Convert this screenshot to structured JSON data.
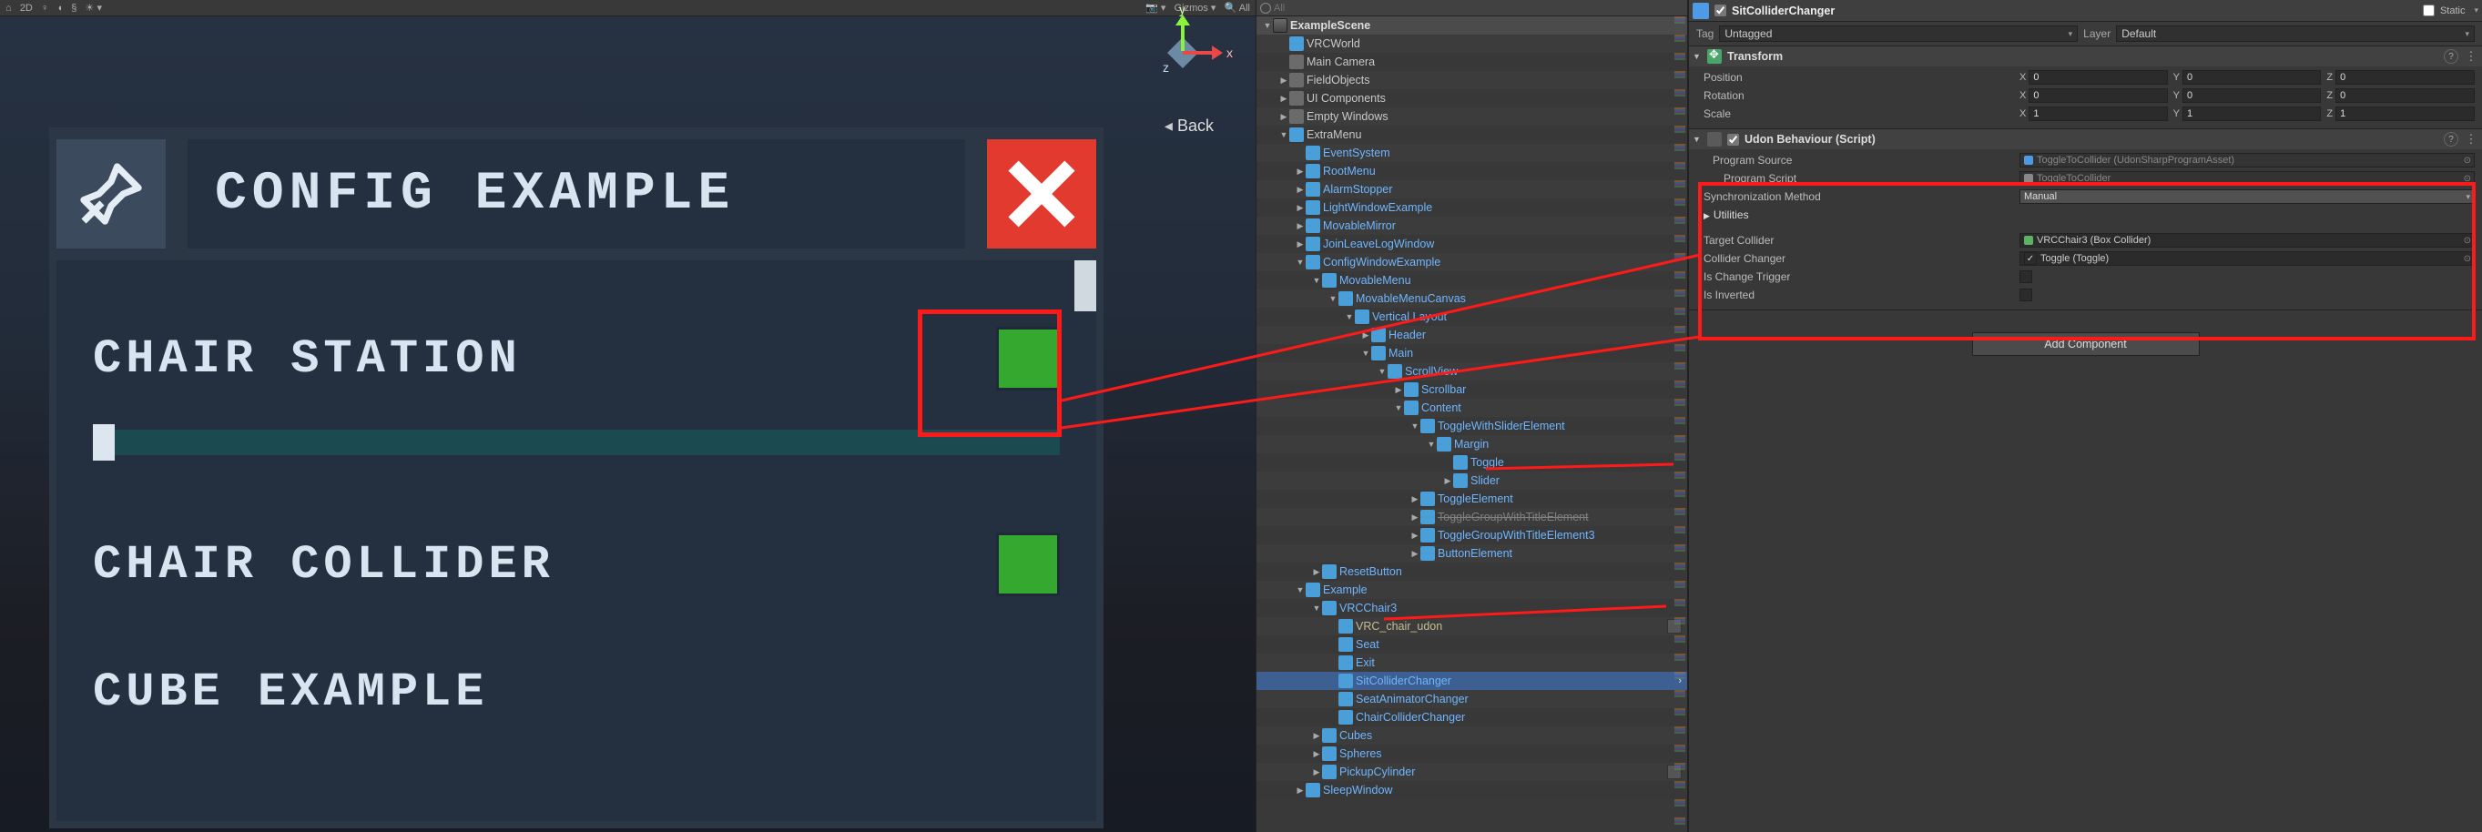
{
  "scene_toolbar": {
    "items": [
      "⌂",
      "2D",
      "♀",
      "◖",
      "§",
      "☀",
      "▾",
      "",
      "",
      "📷",
      "▾",
      "Gizmos",
      "▾",
      "🔍 All"
    ]
  },
  "scene_gizmo": {
    "x": "x",
    "y": "y",
    "z": "z",
    "back": "Back"
  },
  "config_panel": {
    "title": "CONFIG EXAMPLE",
    "rows": [
      {
        "label": "CHAIR STATION",
        "type": "toggle"
      },
      {
        "label": "",
        "type": "slider"
      },
      {
        "label": "CHAIR COLLIDER",
        "type": "toggle"
      },
      {
        "label": "CUBE EXAMPLE",
        "type": "title-only"
      }
    ]
  },
  "hierarchy": {
    "search_placeholder": "All",
    "items": [
      {
        "d": 0,
        "t": "scene",
        "label": "ExampleScene",
        "open": true
      },
      {
        "d": 1,
        "t": "prefab",
        "label": "VRCWorld",
        "leaf": true
      },
      {
        "d": 1,
        "t": "obj",
        "label": "Main Camera",
        "leaf": true
      },
      {
        "d": 1,
        "t": "obj",
        "label": "FieldObjects",
        "open": false
      },
      {
        "d": 1,
        "t": "obj",
        "label": "UI Components",
        "open": false
      },
      {
        "d": 1,
        "t": "obj",
        "label": "Empty Windows",
        "open": false
      },
      {
        "d": 1,
        "t": "prefab",
        "label": "ExtraMenu",
        "open": true
      },
      {
        "d": 2,
        "t": "prefab",
        "label": "EventSystem",
        "cls": "blue",
        "leaf": true
      },
      {
        "d": 2,
        "t": "prefab",
        "label": "RootMenu",
        "cls": "blue",
        "open": false
      },
      {
        "d": 2,
        "t": "prefab",
        "label": "AlarmStopper",
        "cls": "blue",
        "open": false
      },
      {
        "d": 2,
        "t": "prefab",
        "label": "LightWindowExample",
        "cls": "blue",
        "open": false
      },
      {
        "d": 2,
        "t": "prefab",
        "label": "MovableMirror",
        "cls": "blue",
        "open": false
      },
      {
        "d": 2,
        "t": "prefab",
        "label": "JoinLeaveLogWindow",
        "cls": "blue",
        "open": false
      },
      {
        "d": 2,
        "t": "prefab",
        "label": "ConfigWindowExample",
        "cls": "blue",
        "open": true
      },
      {
        "d": 3,
        "t": "prefab",
        "label": "MovableMenu",
        "cls": "blue",
        "open": true
      },
      {
        "d": 4,
        "t": "prefab",
        "label": "MovableMenuCanvas",
        "cls": "blue",
        "open": true
      },
      {
        "d": 5,
        "t": "prefab",
        "label": "Vertical Layout",
        "cls": "blue",
        "open": true
      },
      {
        "d": 6,
        "t": "prefab",
        "label": "Header",
        "cls": "blue",
        "open": false
      },
      {
        "d": 6,
        "t": "prefab",
        "label": "Main",
        "cls": "blue",
        "open": true
      },
      {
        "d": 7,
        "t": "prefab",
        "label": "ScrollView",
        "cls": "blue",
        "open": true
      },
      {
        "d": 8,
        "t": "prefab",
        "label": "Scrollbar",
        "cls": "blue",
        "open": false
      },
      {
        "d": 8,
        "t": "prefab",
        "label": "Content",
        "cls": "blue",
        "open": true
      },
      {
        "d": 9,
        "t": "prefab",
        "label": "ToggleWithSliderElement",
        "cls": "blue",
        "open": true
      },
      {
        "d": 10,
        "t": "prefab",
        "label": "Margin",
        "cls": "blue",
        "open": true
      },
      {
        "d": 11,
        "t": "prefab",
        "label": "Toggle",
        "cls": "blue",
        "leaf": true
      },
      {
        "d": 11,
        "t": "prefab",
        "label": "Slider",
        "cls": "blue",
        "open": false
      },
      {
        "d": 9,
        "t": "prefab",
        "label": "ToggleElement",
        "cls": "blue",
        "open": false
      },
      {
        "d": 9,
        "t": "prefab",
        "label": "ToggleGroupWithTitleElement",
        "cls": "faded",
        "open": false,
        "strike": true
      },
      {
        "d": 9,
        "t": "prefab",
        "label": "ToggleGroupWithTitleElement3",
        "cls": "blue",
        "open": false
      },
      {
        "d": 9,
        "t": "prefab",
        "label": "ButtonElement",
        "cls": "blue",
        "open": false
      },
      {
        "d": 3,
        "t": "prefab",
        "label": "ResetButton",
        "cls": "blue",
        "open": false
      },
      {
        "d": 2,
        "t": "prefab",
        "label": "Example",
        "cls": "blue",
        "open": true
      },
      {
        "d": 3,
        "t": "prefab",
        "label": "VRCChair3",
        "cls": "blue",
        "open": true
      },
      {
        "d": 4,
        "t": "prefab",
        "label": "VRC_chair_udon",
        "cls": "olive",
        "leaf": true,
        "badge": true
      },
      {
        "d": 4,
        "t": "prefab",
        "label": "Seat",
        "cls": "blue",
        "leaf": true
      },
      {
        "d": 4,
        "t": "prefab",
        "label": "Exit",
        "cls": "blue",
        "leaf": true
      },
      {
        "d": 4,
        "t": "prefab",
        "label": "SitColliderChanger",
        "cls": "blue",
        "sel": true,
        "leaf": true
      },
      {
        "d": 4,
        "t": "prefab",
        "label": "SeatAnimatorChanger",
        "cls": "blue",
        "leaf": true
      },
      {
        "d": 4,
        "t": "prefab",
        "label": "ChairColliderChanger",
        "cls": "blue",
        "leaf": true
      },
      {
        "d": 3,
        "t": "prefab",
        "label": "Cubes",
        "cls": "blue",
        "open": false
      },
      {
        "d": 3,
        "t": "prefab",
        "label": "Spheres",
        "cls": "blue",
        "open": false
      },
      {
        "d": 3,
        "t": "prefab",
        "label": "PickupCylinder",
        "cls": "blue",
        "open": false,
        "badge": true
      },
      {
        "d": 2,
        "t": "prefab",
        "label": "SleepWindow",
        "cls": "blue",
        "open": false
      }
    ]
  },
  "inspector": {
    "name": "SitColliderChanger",
    "enabled": true,
    "static_label": "Static",
    "tag_label": "Tag",
    "tag_value": "Untagged",
    "layer_label": "Layer",
    "layer_value": "Default",
    "transform": {
      "title": "Transform",
      "rows": [
        {
          "label": "Position",
          "x": "0",
          "y": "0",
          "z": "0"
        },
        {
          "label": "Rotation",
          "x": "0",
          "y": "0",
          "z": "0"
        },
        {
          "label": "Scale",
          "x": "1",
          "y": "1",
          "z": "1"
        }
      ]
    },
    "udon": {
      "title": "Udon Behaviour (Script)",
      "enabled": true,
      "program_source_label": "Program Source",
      "program_source_value": "ToggleToCollider (UdonSharpProgramAsset)",
      "program_script_label": "Program Script",
      "program_script_value": "ToggleToCollider",
      "sync_label": "Synchronization Method",
      "sync_value": "Manual",
      "utilities_label": "Utilities",
      "target_collider_label": "Target Collider",
      "target_collider_value": "VRCChair3 (Box Collider)",
      "collider_changer_label": "Collider Changer",
      "collider_changer_value": "Toggle (Toggle)",
      "is_change_trigger_label": "Is Change Trigger",
      "is_inverted_label": "Is Inverted"
    },
    "add_component": "Add Component"
  }
}
